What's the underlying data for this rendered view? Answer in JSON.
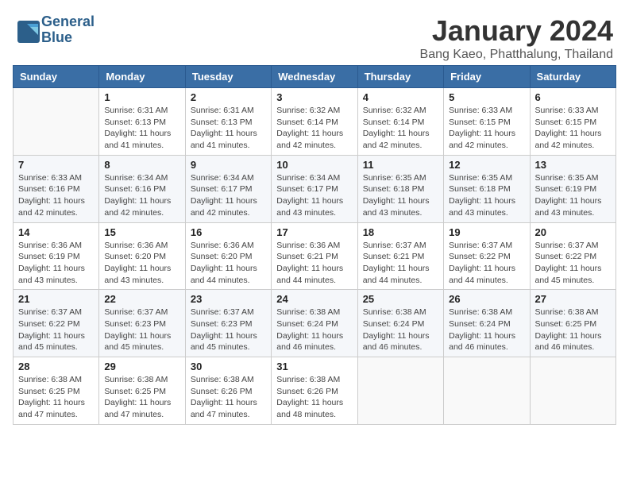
{
  "header": {
    "logo_line1": "General",
    "logo_line2": "Blue",
    "month": "January 2024",
    "location": "Bang Kaeo, Phatthalung, Thailand"
  },
  "weekdays": [
    "Sunday",
    "Monday",
    "Tuesday",
    "Wednesday",
    "Thursday",
    "Friday",
    "Saturday"
  ],
  "weeks": [
    [
      {
        "day": "",
        "info": ""
      },
      {
        "day": "1",
        "info": "Sunrise: 6:31 AM\nSunset: 6:13 PM\nDaylight: 11 hours\nand 41 minutes."
      },
      {
        "day": "2",
        "info": "Sunrise: 6:31 AM\nSunset: 6:13 PM\nDaylight: 11 hours\nand 41 minutes."
      },
      {
        "day": "3",
        "info": "Sunrise: 6:32 AM\nSunset: 6:14 PM\nDaylight: 11 hours\nand 42 minutes."
      },
      {
        "day": "4",
        "info": "Sunrise: 6:32 AM\nSunset: 6:14 PM\nDaylight: 11 hours\nand 42 minutes."
      },
      {
        "day": "5",
        "info": "Sunrise: 6:33 AM\nSunset: 6:15 PM\nDaylight: 11 hours\nand 42 minutes."
      },
      {
        "day": "6",
        "info": "Sunrise: 6:33 AM\nSunset: 6:15 PM\nDaylight: 11 hours\nand 42 minutes."
      }
    ],
    [
      {
        "day": "7",
        "info": "Sunrise: 6:33 AM\nSunset: 6:16 PM\nDaylight: 11 hours\nand 42 minutes."
      },
      {
        "day": "8",
        "info": "Sunrise: 6:34 AM\nSunset: 6:16 PM\nDaylight: 11 hours\nand 42 minutes."
      },
      {
        "day": "9",
        "info": "Sunrise: 6:34 AM\nSunset: 6:17 PM\nDaylight: 11 hours\nand 42 minutes."
      },
      {
        "day": "10",
        "info": "Sunrise: 6:34 AM\nSunset: 6:17 PM\nDaylight: 11 hours\nand 43 minutes."
      },
      {
        "day": "11",
        "info": "Sunrise: 6:35 AM\nSunset: 6:18 PM\nDaylight: 11 hours\nand 43 minutes."
      },
      {
        "day": "12",
        "info": "Sunrise: 6:35 AM\nSunset: 6:18 PM\nDaylight: 11 hours\nand 43 minutes."
      },
      {
        "day": "13",
        "info": "Sunrise: 6:35 AM\nSunset: 6:19 PM\nDaylight: 11 hours\nand 43 minutes."
      }
    ],
    [
      {
        "day": "14",
        "info": "Sunrise: 6:36 AM\nSunset: 6:19 PM\nDaylight: 11 hours\nand 43 minutes."
      },
      {
        "day": "15",
        "info": "Sunrise: 6:36 AM\nSunset: 6:20 PM\nDaylight: 11 hours\nand 43 minutes."
      },
      {
        "day": "16",
        "info": "Sunrise: 6:36 AM\nSunset: 6:20 PM\nDaylight: 11 hours\nand 44 minutes."
      },
      {
        "day": "17",
        "info": "Sunrise: 6:36 AM\nSunset: 6:21 PM\nDaylight: 11 hours\nand 44 minutes."
      },
      {
        "day": "18",
        "info": "Sunrise: 6:37 AM\nSunset: 6:21 PM\nDaylight: 11 hours\nand 44 minutes."
      },
      {
        "day": "19",
        "info": "Sunrise: 6:37 AM\nSunset: 6:22 PM\nDaylight: 11 hours\nand 44 minutes."
      },
      {
        "day": "20",
        "info": "Sunrise: 6:37 AM\nSunset: 6:22 PM\nDaylight: 11 hours\nand 45 minutes."
      }
    ],
    [
      {
        "day": "21",
        "info": "Sunrise: 6:37 AM\nSunset: 6:22 PM\nDaylight: 11 hours\nand 45 minutes."
      },
      {
        "day": "22",
        "info": "Sunrise: 6:37 AM\nSunset: 6:23 PM\nDaylight: 11 hours\nand 45 minutes."
      },
      {
        "day": "23",
        "info": "Sunrise: 6:37 AM\nSunset: 6:23 PM\nDaylight: 11 hours\nand 45 minutes."
      },
      {
        "day": "24",
        "info": "Sunrise: 6:38 AM\nSunset: 6:24 PM\nDaylight: 11 hours\nand 46 minutes."
      },
      {
        "day": "25",
        "info": "Sunrise: 6:38 AM\nSunset: 6:24 PM\nDaylight: 11 hours\nand 46 minutes."
      },
      {
        "day": "26",
        "info": "Sunrise: 6:38 AM\nSunset: 6:24 PM\nDaylight: 11 hours\nand 46 minutes."
      },
      {
        "day": "27",
        "info": "Sunrise: 6:38 AM\nSunset: 6:25 PM\nDaylight: 11 hours\nand 46 minutes."
      }
    ],
    [
      {
        "day": "28",
        "info": "Sunrise: 6:38 AM\nSunset: 6:25 PM\nDaylight: 11 hours\nand 47 minutes."
      },
      {
        "day": "29",
        "info": "Sunrise: 6:38 AM\nSunset: 6:25 PM\nDaylight: 11 hours\nand 47 minutes."
      },
      {
        "day": "30",
        "info": "Sunrise: 6:38 AM\nSunset: 6:26 PM\nDaylight: 11 hours\nand 47 minutes."
      },
      {
        "day": "31",
        "info": "Sunrise: 6:38 AM\nSunset: 6:26 PM\nDaylight: 11 hours\nand 48 minutes."
      },
      {
        "day": "",
        "info": ""
      },
      {
        "day": "",
        "info": ""
      },
      {
        "day": "",
        "info": ""
      }
    ]
  ]
}
